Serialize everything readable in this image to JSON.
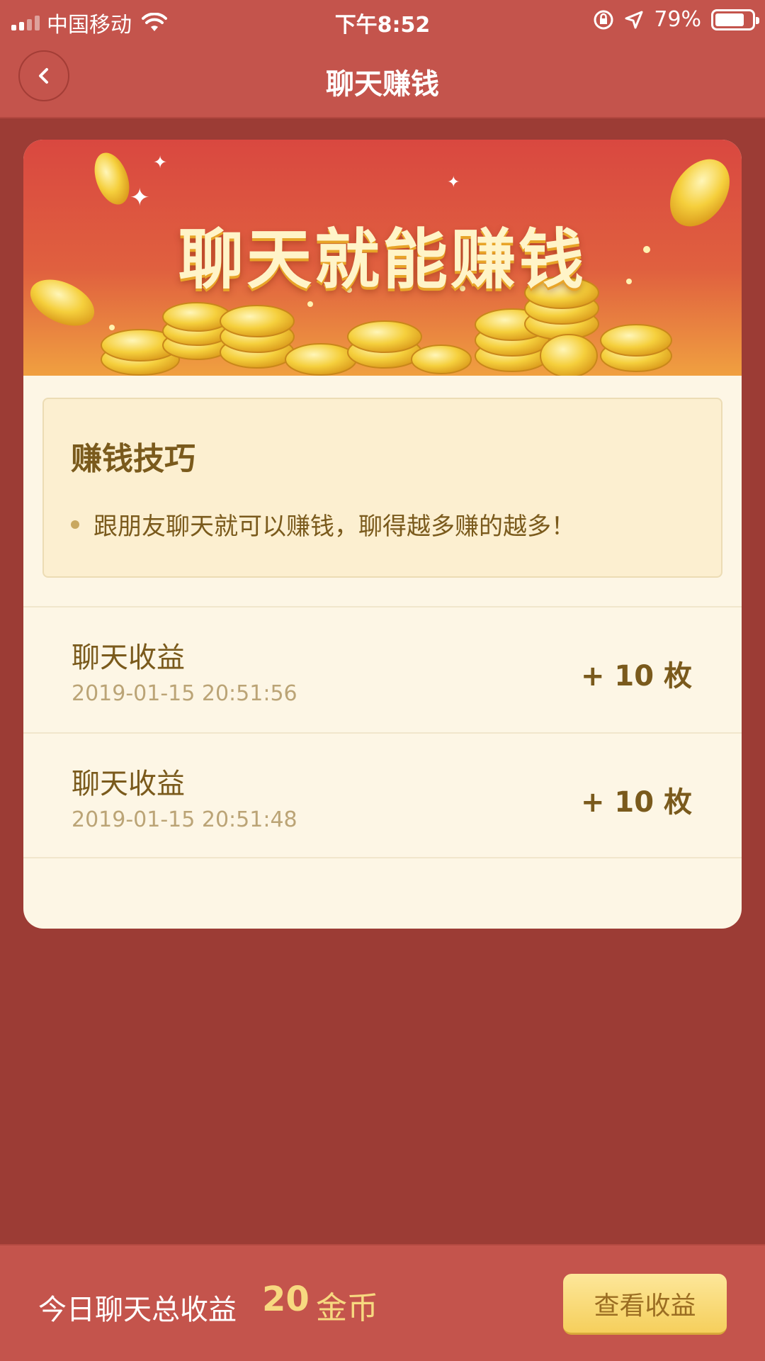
{
  "status_bar": {
    "carrier": "中国移动",
    "time": "下午8:52",
    "battery_percent": "79%",
    "battery_level": 0.79,
    "icons": [
      "signal-icon",
      "wifi-icon",
      "rotation-lock-icon",
      "location-arrow-icon",
      "battery-icon"
    ]
  },
  "nav": {
    "title": "聊天赚钱",
    "back_icon": "chevron-left-icon"
  },
  "banner": {
    "title": "聊天就能赚钱"
  },
  "tips": {
    "title": "赚钱技巧",
    "items": [
      "跟朋友聊天就可以赚钱，聊得越多赚的越多！"
    ]
  },
  "records": [
    {
      "title": "聊天收益",
      "time": "2019-01-15 20:51:56",
      "amount": "+ 10 枚"
    },
    {
      "title": "聊天收益",
      "time": "2019-01-15 20:51:48",
      "amount": "+ 10 枚"
    }
  ],
  "footer": {
    "label": "今日聊天总收益",
    "value": "20",
    "unit": "金币",
    "button_label": "查看收益"
  },
  "colors": {
    "page_bg": "#9c3c35",
    "bar_bg": "#c4544c",
    "card_bg": "#fdf6e5",
    "text_brown": "#7a5a1c",
    "gold": "#f7d980"
  }
}
